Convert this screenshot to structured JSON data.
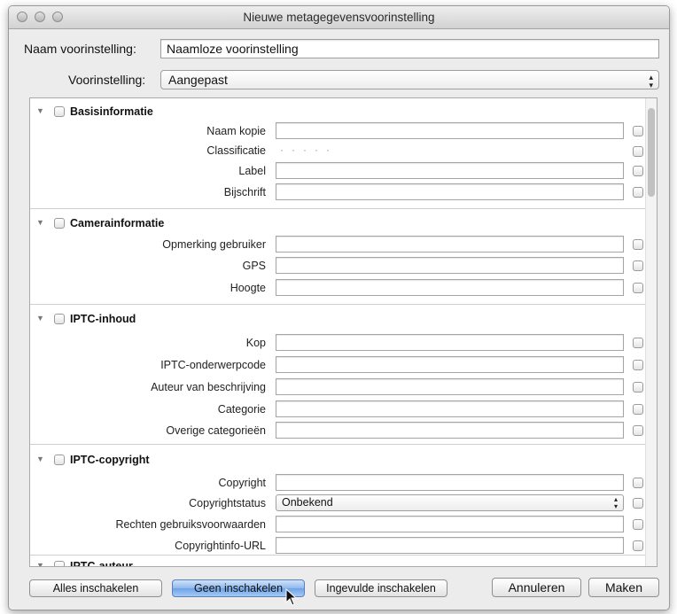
{
  "window": {
    "title": "Nieuwe metagegevensvoorinstelling"
  },
  "preset_name": {
    "label": "Naam voorinstelling:",
    "value": "Naamloze voorinstelling"
  },
  "preset": {
    "label": "Voorinstelling:",
    "value": "Aangepast"
  },
  "sections": {
    "basic": {
      "title": "Basisinformatie",
      "fields": [
        {
          "label": "Naam kopie",
          "value": ""
        },
        {
          "label": "Classificatie",
          "value": ""
        },
        {
          "label": "Label",
          "value": ""
        },
        {
          "label": "Bijschrift",
          "value": ""
        }
      ]
    },
    "camera": {
      "title": "Camerainformatie",
      "fields": [
        {
          "label": "Opmerking gebruiker",
          "value": ""
        },
        {
          "label": "GPS",
          "value": ""
        },
        {
          "label": "Hoogte",
          "value": ""
        }
      ]
    },
    "iptc_content": {
      "title": "IPTC-inhoud",
      "fields": [
        {
          "label": "Kop",
          "value": ""
        },
        {
          "label": "IPTC-onderwerpcode",
          "value": ""
        },
        {
          "label": "Auteur van beschrijving",
          "value": ""
        },
        {
          "label": "Categorie",
          "value": ""
        },
        {
          "label": "Overige categorieën",
          "value": ""
        }
      ]
    },
    "iptc_copyright": {
      "title": "IPTC-copyright",
      "fields": [
        {
          "label": "Copyright",
          "value": ""
        },
        {
          "label": "Copyrightstatus",
          "value": "Onbekend"
        },
        {
          "label": "Rechten gebruiksvoorwaarden",
          "value": ""
        },
        {
          "label": "Copyrightinfo-URL",
          "value": ""
        }
      ]
    },
    "iptc_author": {
      "title": "IPTC-auteur"
    }
  },
  "buttons": {
    "enable_all": "Alles inschakelen",
    "enable_none": "Geen inschakelen",
    "enable_filled": "Ingevulde inschakelen",
    "cancel": "Annuleren",
    "create": "Maken"
  }
}
